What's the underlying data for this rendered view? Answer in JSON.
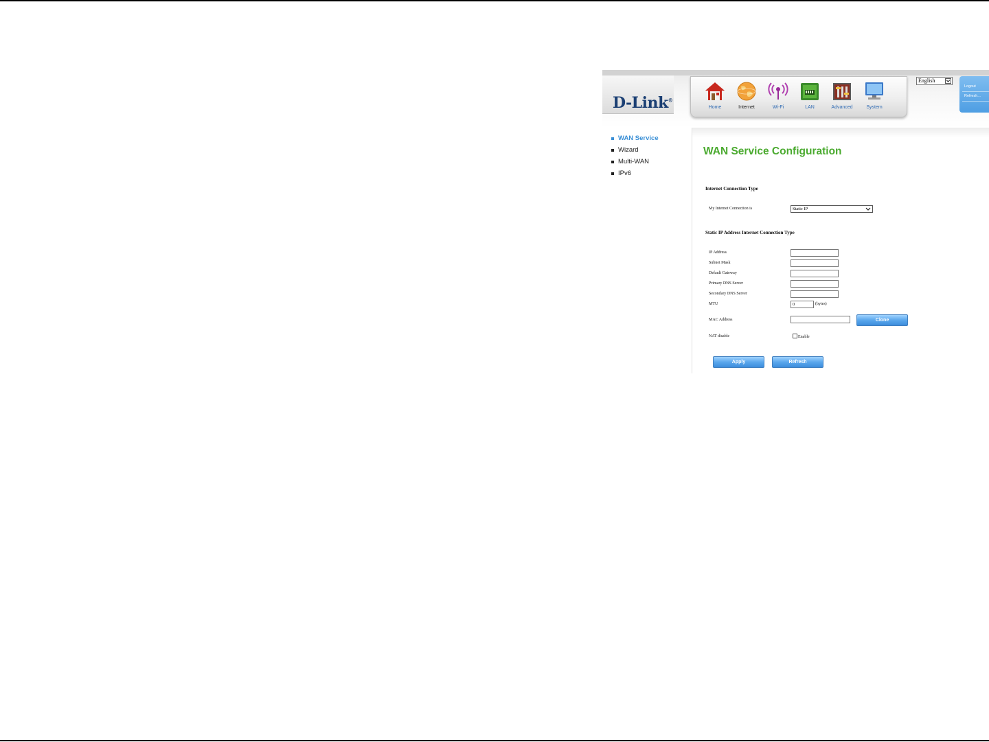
{
  "header": {
    "logo": "D-Link",
    "nav": [
      {
        "label": "Home",
        "icon": "home-icon"
      },
      {
        "label": "Internet",
        "icon": "globe-icon"
      },
      {
        "label": "Wi-Fi",
        "icon": "wifi-icon"
      },
      {
        "label": "LAN",
        "icon": "lan-icon"
      },
      {
        "label": "Advanced",
        "icon": "advanced-icon"
      },
      {
        "label": "System",
        "icon": "monitor-icon"
      }
    ],
    "active_nav": "Internet",
    "language": "English",
    "side_links": [
      "Logout",
      "Refresh..."
    ]
  },
  "sidebar": {
    "items": [
      {
        "label": "WAN Service",
        "active": true
      },
      {
        "label": "Wizard",
        "active": false
      },
      {
        "label": "Multi-WAN",
        "active": false
      },
      {
        "label": "IPv6",
        "active": false
      }
    ]
  },
  "main": {
    "title": "WAN Service Configuration",
    "section1": "Internet Connection Type",
    "connection_label": "My Internet Connection is",
    "connection_value": "Static IP",
    "section2": "Static IP Address Internet Connection Type",
    "fields": [
      {
        "label": "IP Address",
        "value": ""
      },
      {
        "label": "Subnet Mask",
        "value": ""
      },
      {
        "label": "Default Gateway",
        "value": ""
      },
      {
        "label": "Primary DNS Server",
        "value": ""
      },
      {
        "label": "Secondary DNS Server",
        "value": ""
      }
    ],
    "mtu_label": "MTU",
    "mtu_value": "0",
    "mtu_unit": "(bytes)",
    "mac_label": "MAC Address",
    "mac_value": "",
    "clone_label": "Clone",
    "nat_label": "NAT disable",
    "nat_enable_label": "Enable",
    "nat_checked": false,
    "apply_label": "Apply",
    "refresh_label": "Refresh"
  },
  "colors": {
    "accent_blue": "#3a8fd6",
    "title_green": "#4aaa2f",
    "logo_blue": "#1b3f73"
  }
}
